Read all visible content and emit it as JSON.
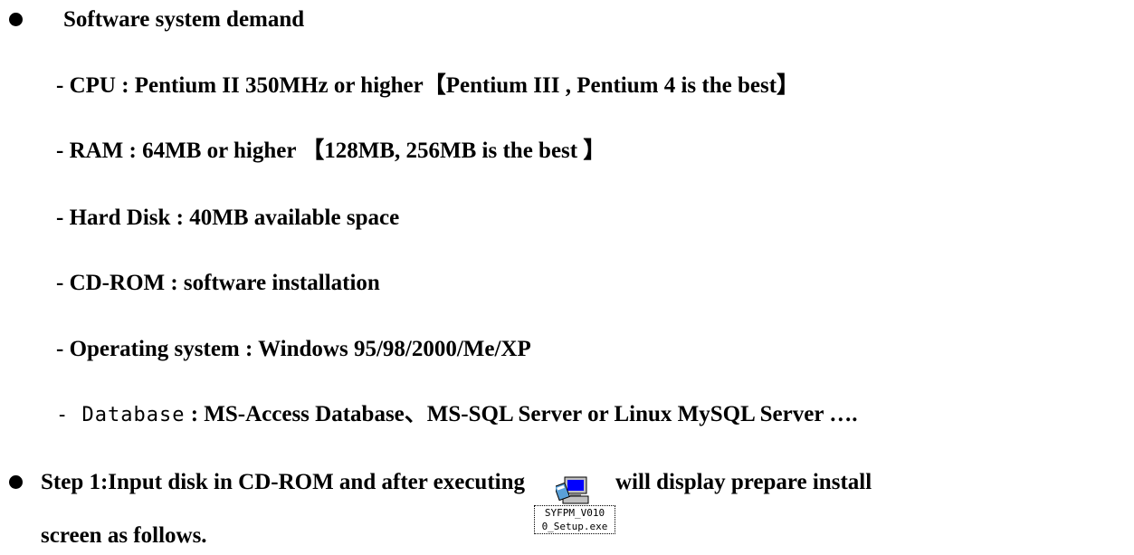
{
  "section1": {
    "heading": "Software system demand",
    "items": [
      "- CPU : Pentium II 350MHz or higher【Pentium  III , Pentium 4  is the best】",
      "- RAM : 64MB or higher 【128MB, 256MB is the best 】",
      "- Hard Disk : 40MB  available space",
      "- CD-ROM : software installation",
      "- Operating system : Windows 95/98/2000/Me/XP"
    ],
    "database_prefix": "- Database",
    "database_rest": " : MS-Access Database、MS-SQL Server or Linux MySQL Server …."
  },
  "section2": {
    "step_before_icon": "Step 1:Input  disk in CD-ROM and after executing ",
    "step_after_icon": "will display prepare install",
    "step_line2": "screen as follows.",
    "icon": {
      "name": "installer-icon",
      "caption_line1": "SYFPM_V010",
      "caption_line2": "0_Setup.exe"
    }
  }
}
